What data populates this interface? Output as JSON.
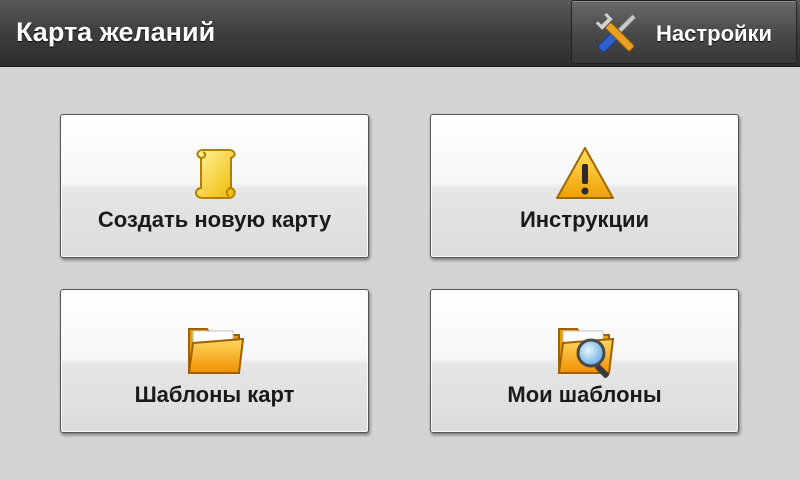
{
  "header": {
    "title": "Карта желаний",
    "settings_label": "Настройки",
    "settings_icon": "tools-icon"
  },
  "tiles": [
    {
      "label": "Создать новую карту",
      "icon": "scroll-icon"
    },
    {
      "label": "Инструкции",
      "icon": "warning-icon"
    },
    {
      "label": "Шаблоны карт",
      "icon": "folder-icon"
    },
    {
      "label": "Мои шаблоны",
      "icon": "folder-search-icon"
    }
  ],
  "colors": {
    "header_bg": "#3d3d3d",
    "background": "#d4d4d4",
    "icon_yellow": "#f5c518",
    "text_dark": "#1a1a1a"
  }
}
